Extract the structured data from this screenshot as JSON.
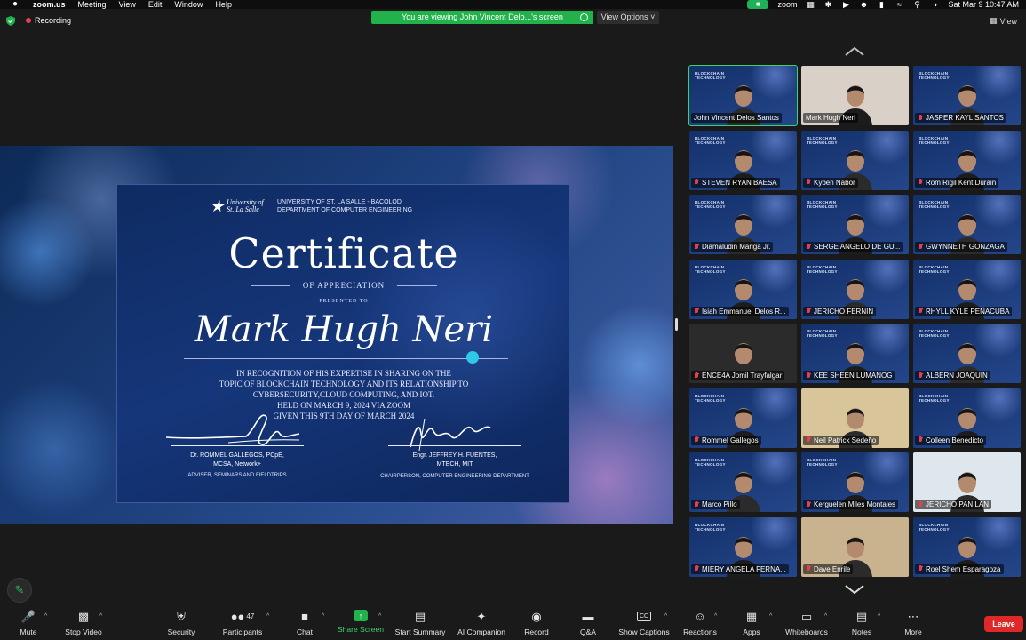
{
  "menubar": {
    "app": "zoom.us",
    "items": [
      "Meeting",
      "View",
      "Edit",
      "Window",
      "Help"
    ],
    "clock": "Sat Mar 9  10:47 AM",
    "zoom_label": "zoom"
  },
  "top": {
    "recording": "Recording",
    "banner": "You are viewing John Vincent Delo...'s screen",
    "view_options": "View Options",
    "view": "View"
  },
  "certificate": {
    "logo_line1": "University of",
    "logo_line2": "St. La Salle",
    "university": "UNIVERSITY OF ST. LA SALLE - BACOLOD",
    "department": "DEPARTMENT OF COMPUTER ENGINEERING",
    "title": "Certificate",
    "subtitle": "OF APPRECIATION",
    "presented": "PRESENTED TO",
    "recipient": "Mark Hugh Neri",
    "body_1": "IN RECOGNITION OF HIS EXPERTISE IN SHARING ON THE",
    "body_2": "TOPIC OF BLOCKCHAIN TECHNOLOGY AND ITS RELATIONSHIP TO",
    "body_3": "CYBERSECURITY,CLOUD COMPUTING, AND IOT.",
    "body_4": "HELD ON MARCH 9, 2024 VIA ZOOM",
    "body_5": "GIVEN THIS 9TH DAY OF MARCH 2024",
    "signer1_name": "Dr. ROMMEL GALLEGOS, PCpE,",
    "signer1_cred": "MCSA, Network+",
    "signer1_role": "ADVISER, SEMINARS AND FIELDTRIPS",
    "signer2_name": "Engr. JEFFREY H. FUENTES,",
    "signer2_cred": "MTECH, MIT",
    "signer2_role": "CHAIRPERSON, COMPUTER ENGINEERING DEPARTMENT"
  },
  "gallery": {
    "slide_label_1": "BLOCKCHAIN",
    "slide_label_2": "TECHNOLOGY",
    "tiles": [
      {
        "name": "John Vincent Delos Santos",
        "muted": false
      },
      {
        "name": "Mark Hugh Neri",
        "muted": false
      },
      {
        "name": "JASPER KAYL SANTOS",
        "muted": true
      },
      {
        "name": "STEVEN RYAN BAESA",
        "muted": true
      },
      {
        "name": "Kyben Nabor",
        "muted": true
      },
      {
        "name": "Rom Rigil Kent Durain",
        "muted": true
      },
      {
        "name": "Diamaludin Mariga Jr.",
        "muted": true
      },
      {
        "name": "SERGE ANGELO DE GU...",
        "muted": true
      },
      {
        "name": "GWYNNETH GONZAGA",
        "muted": true
      },
      {
        "name": "Isiah Emmanuel Delos R...",
        "muted": true
      },
      {
        "name": "JERICHO FERNIN",
        "muted": true
      },
      {
        "name": "RHYLL KYLE PEÑACUBA",
        "muted": true
      },
      {
        "name": "ENCE4A Jomil Trayfalgar",
        "muted": true
      },
      {
        "name": "KEE SHEEN LUMANOG",
        "muted": true
      },
      {
        "name": "ALBERN JOAQUIN",
        "muted": true
      },
      {
        "name": "Rommel Gallegos",
        "muted": true
      },
      {
        "name": "Neil Patrick Sedeño",
        "muted": true
      },
      {
        "name": "Colleen Benedicto",
        "muted": true
      },
      {
        "name": "Marco Pillo",
        "muted": true
      },
      {
        "name": "Kerguelen Miles Montales",
        "muted": true
      },
      {
        "name": "JERICHO PANILAN",
        "muted": true
      },
      {
        "name": "MIERY ANGELA FERNA...",
        "muted": true
      },
      {
        "name": "Dave Enrile",
        "muted": true
      },
      {
        "name": "Roel Shem Esparagoza",
        "muted": true
      }
    ]
  },
  "toolbar": {
    "mute": "Mute",
    "stop_video": "Stop Video",
    "security": "Security",
    "participants": "Participants",
    "participants_count": "47",
    "chat": "Chat",
    "share_screen": "Share Screen",
    "start_summary": "Start Summary",
    "ai_companion": "AI Companion",
    "record": "Record",
    "qa": "Q&A",
    "show_captions": "Show Captions",
    "reactions": "Reactions",
    "apps": "Apps",
    "whiteboards": "Whiteboards",
    "notes": "Notes",
    "more": "More",
    "leave": "Leave",
    "cc": "CC"
  }
}
